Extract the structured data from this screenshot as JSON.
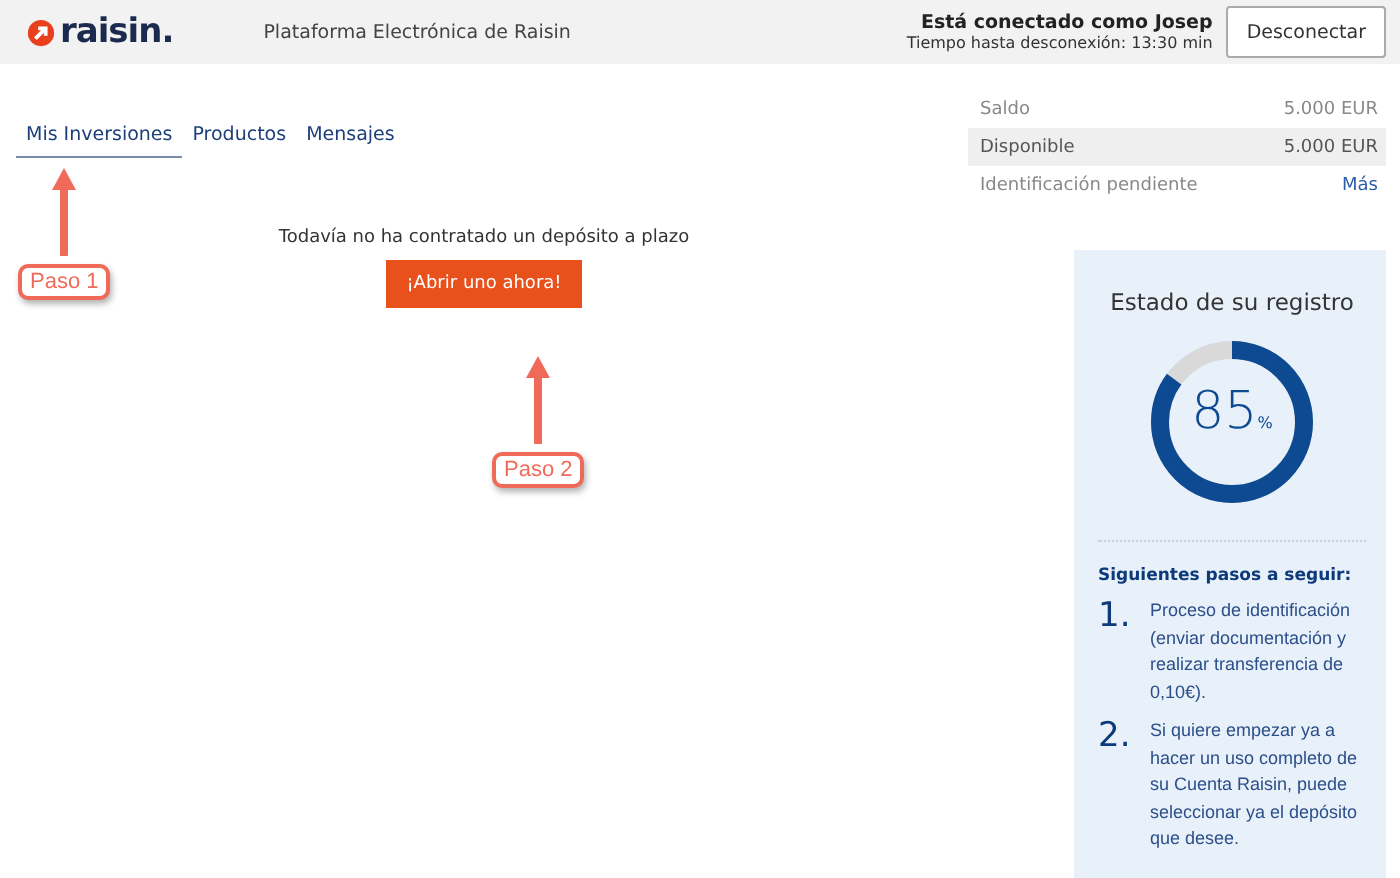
{
  "header": {
    "logo": "raisin.",
    "title": "Plataforma Electrónica de Raisin",
    "user": "Está conectado como Josep",
    "timeout": "Tiempo hasta desconexión: 13:30 min",
    "logout_button": "Desconectar"
  },
  "tabs": [
    {
      "label": "Mis Inversiones",
      "selected": true
    },
    {
      "label": "Productos",
      "selected": false
    },
    {
      "label": "Mensajes",
      "selected": false
    }
  ],
  "empty_message": "Todavía no ha contratado un depósito a plazo",
  "open_button": "¡Abrir uno ahora!",
  "annotations": [
    {
      "label": "Paso 1"
    },
    {
      "label": "Paso 2"
    }
  ],
  "balance": [
    {
      "label": "Saldo",
      "value": "5.000 EUR",
      "kind": "amount",
      "highlighted": false
    },
    {
      "label": "Disponible",
      "value": "5.000 EUR",
      "kind": "amount",
      "highlighted": true
    },
    {
      "label": "Identificación pendiente",
      "value": "Más",
      "kind": "link",
      "highlighted": false
    }
  ],
  "registration": {
    "title": "Estado de su registro",
    "level": 0.85,
    "percent": "85",
    "unit": "%",
    "steps_title": "Siguientes pasos a seguir:",
    "steps": [
      {
        "number": "1.",
        "text": "Proceso de identificación (enviar documentación y realizar transferencia de 0,10€)."
      },
      {
        "number": "2.",
        "text": "Si quiere empezar ya a hacer un uso completo de su Cuenta Raisin, puede seleccionar ya el depósito que desee."
      }
    ]
  }
}
